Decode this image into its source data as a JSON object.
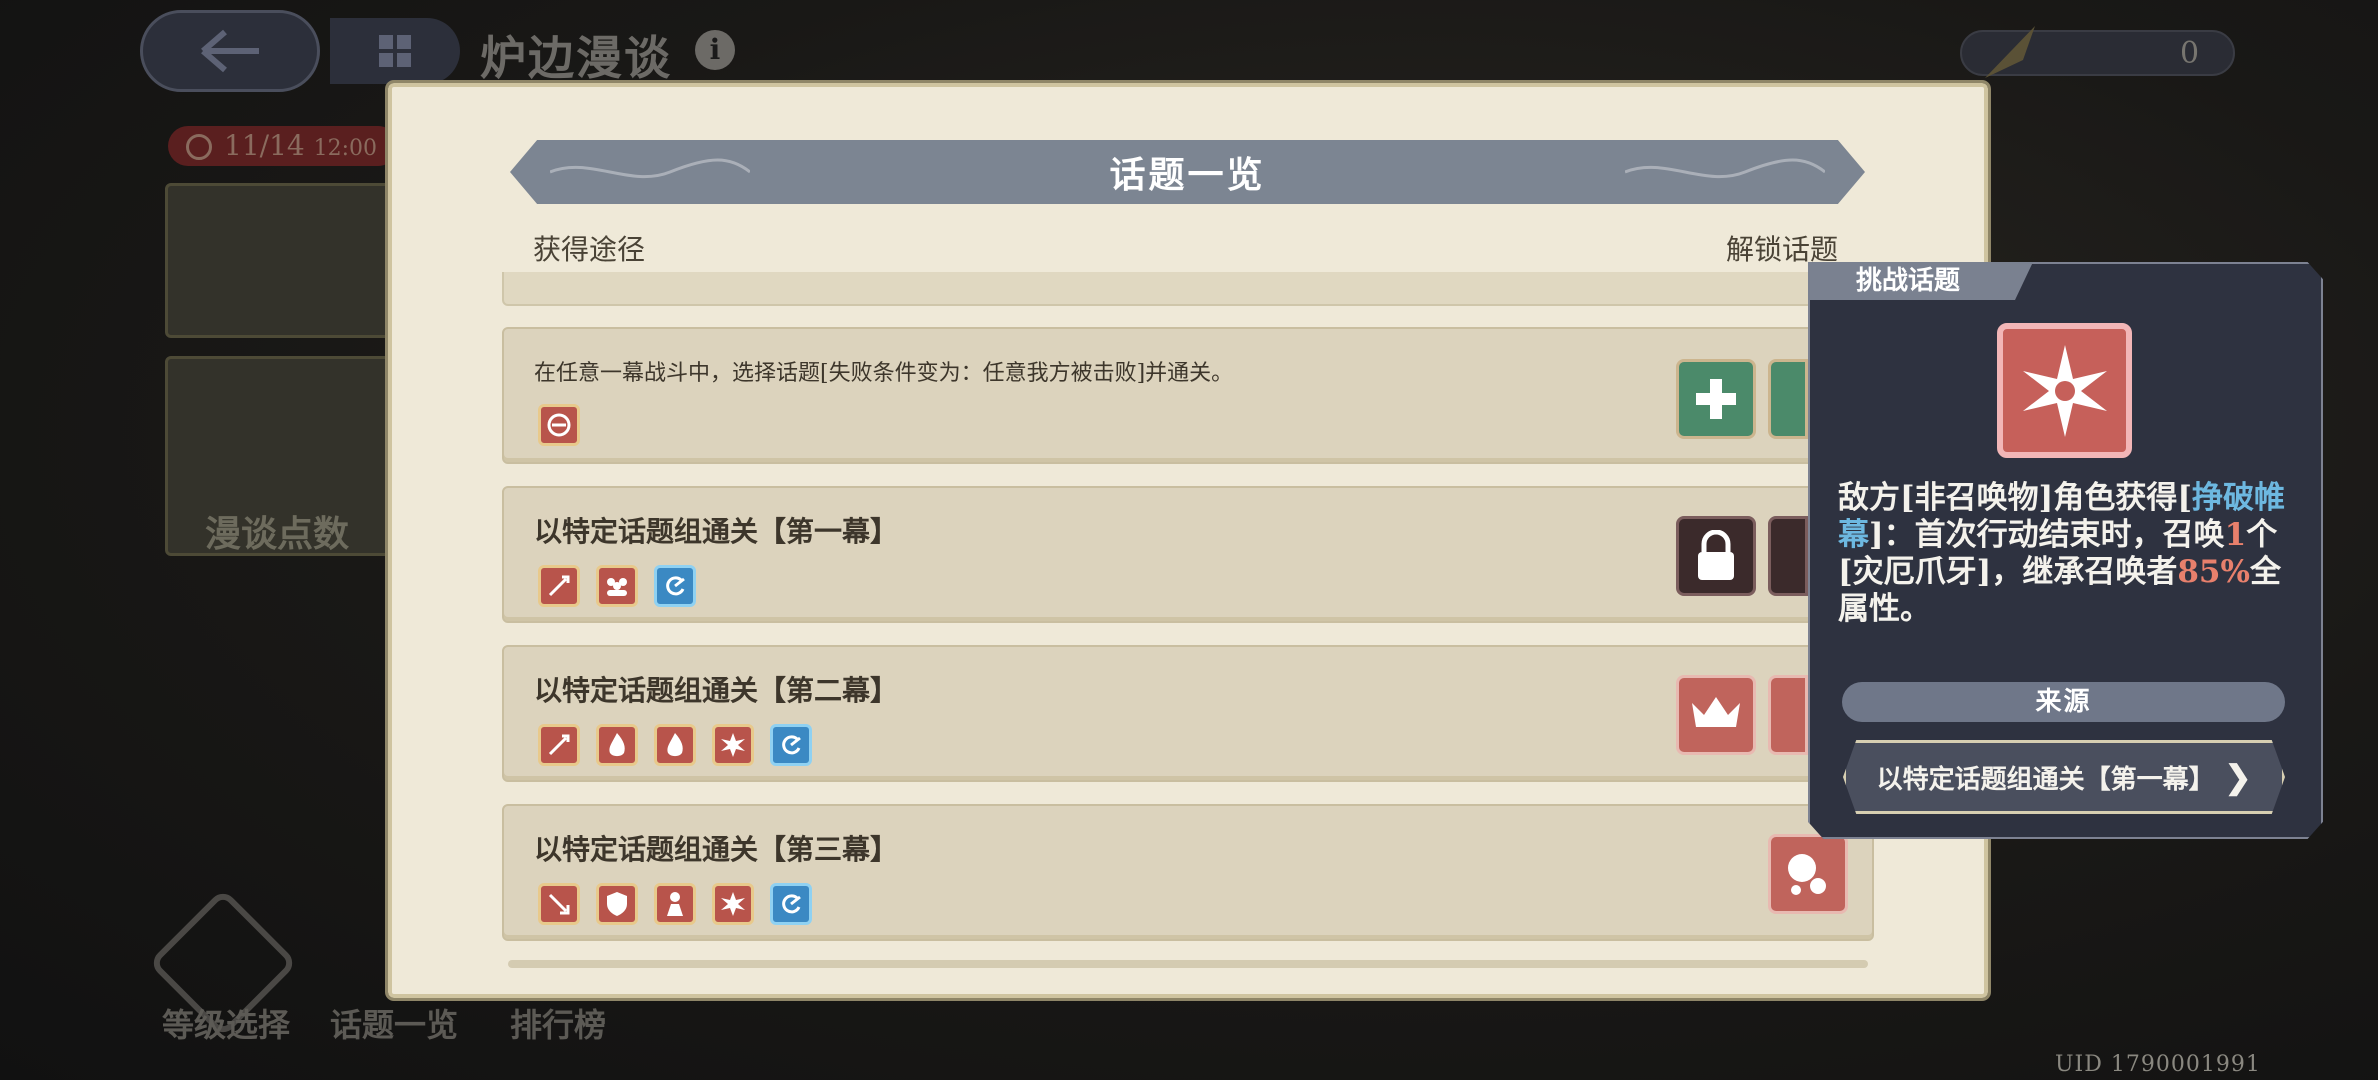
{
  "header": {
    "title": "炉边漫谈",
    "info_icon": "i",
    "currency_value": "0",
    "date_text": "11/14",
    "time_text": "12:00"
  },
  "sidebar": {
    "points_label": "漫谈点数"
  },
  "bottom_nav": [
    {
      "label": "等级选择"
    },
    {
      "label": "话题一览"
    },
    {
      "label": "排行榜"
    }
  ],
  "uid_text": "UID 1790001991",
  "modal": {
    "title": "话题一览",
    "col_source": "获得途径",
    "col_unlock": "解锁话题",
    "rows": [
      {
        "title": "在任意一幕战斗中，选择话题[失败条件变为：任意我方被击败]并通关。",
        "icons": [
          "prohibit-icon"
        ],
        "unlock": [
          "heal-plus-icon",
          "feather-icon"
        ]
      },
      {
        "title": "以特定话题组通关【第一幕】",
        "icons": [
          "sword-up-icon",
          "team-icon",
          "swirl-icon"
        ],
        "unlock": [
          "lock-icon",
          "lock-icon"
        ]
      },
      {
        "title": "以特定话题组通关【第二幕】",
        "icons": [
          "sword-up-icon",
          "flame-icon",
          "flame-icon",
          "burst-icon",
          "swirl-icon"
        ],
        "unlock": [
          "crown-icon",
          "crown-icon"
        ]
      },
      {
        "title": "以特定话题组通关【第三幕】",
        "icons": [
          "sword-down-icon",
          "shield-icon",
          "figure-icon",
          "burst-icon",
          "swirl-icon"
        ],
        "unlock": [
          "bubbles-icon"
        ]
      }
    ]
  },
  "tooltip": {
    "tag": "挑战话题",
    "desc_a": "敌方[非召唤物]角色获得[",
    "desc_hl1": "挣破帷幕",
    "desc_b": "]：首次行动结束时，召唤",
    "desc_hl2": "1",
    "desc_c": "个[灾厄爪牙]，继承召唤者",
    "desc_hl3": "85%",
    "desc_d": "全属性。",
    "source_label": "来源",
    "source_button": "以特定话题组通关【第一幕】"
  },
  "colors": {
    "highlight_blue": "#6db8e0",
    "highlight_red": "#e8806c",
    "icon_red": "#b8544b",
    "icon_blue": "#3b89c3",
    "unlock_green": "#4b8a6a"
  }
}
